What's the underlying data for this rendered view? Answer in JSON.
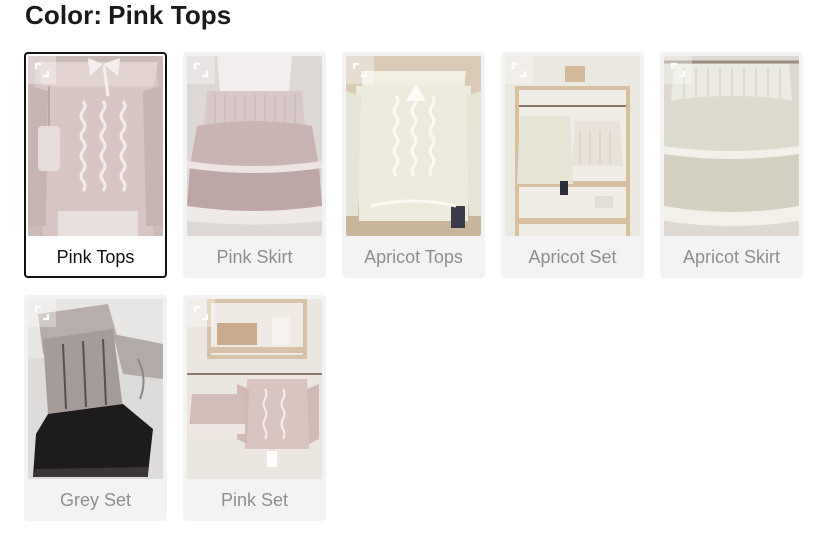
{
  "header": {
    "label": "Color:",
    "value": "Pink Tops"
  },
  "options": [
    {
      "label": "Pink Tops",
      "selected": true,
      "icon": "expand-icon"
    },
    {
      "label": "Pink Skirt",
      "selected": false,
      "icon": "expand-icon"
    },
    {
      "label": "Apricot Tops",
      "selected": false,
      "icon": "expand-icon"
    },
    {
      "label": "Apricot Set",
      "selected": false,
      "icon": "expand-icon"
    },
    {
      "label": "Apricot Skirt",
      "selected": false,
      "icon": "expand-icon"
    },
    {
      "label": "Grey Set",
      "selected": false,
      "icon": "expand-icon"
    },
    {
      "label": "Pink Set",
      "selected": false,
      "icon": "expand-icon"
    }
  ],
  "colors": {
    "selected_border": "#111111",
    "label_muted": "#8e8e8e",
    "tile_bg": "#f3f3f3"
  }
}
